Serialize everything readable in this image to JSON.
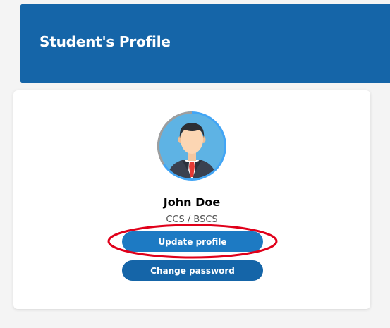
{
  "header": {
    "title": "Student's Profile"
  },
  "profile": {
    "avatar_icon": "user-avatar-icon",
    "name": "John Doe",
    "program": "CCS / BSCS"
  },
  "actions": {
    "update_label": "Update profile",
    "password_label": "Change password"
  },
  "annotation": {
    "highlight_color": "#e0001a",
    "highlighted_element": "update-profile-button"
  },
  "colors": {
    "brand_blue": "#1565a8",
    "button_blue": "#1d7ac3",
    "avatar_ring": "#42a5f5"
  }
}
